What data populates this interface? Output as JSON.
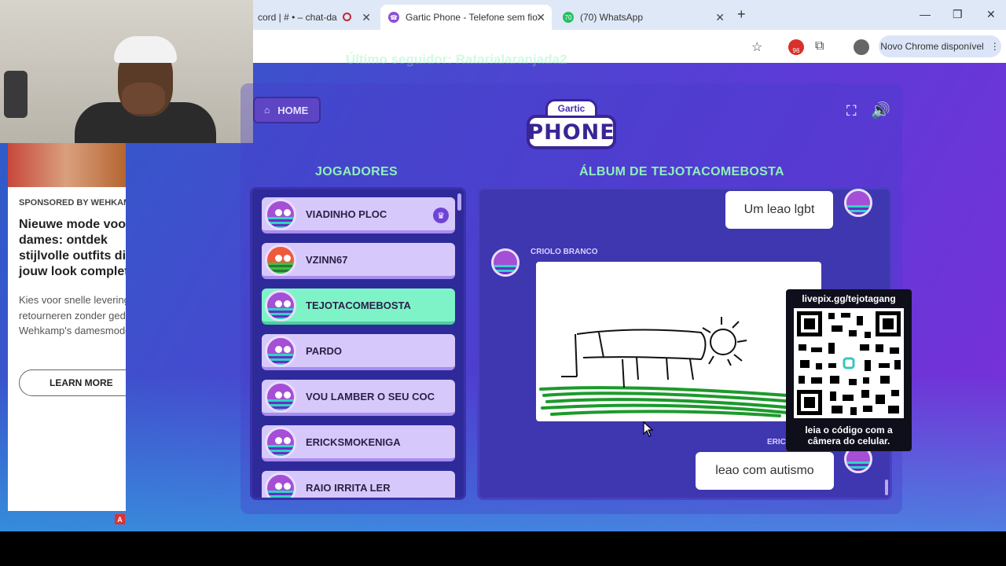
{
  "browser": {
    "tabs": [
      {
        "label": "cord | # • – chat-da",
        "icon": "discord-icon"
      },
      {
        "label": "Gartic Phone - Telefone sem fio",
        "icon": "gartic-icon"
      },
      {
        "label": "(70) WhatsApp",
        "icon": "whatsapp-icon",
        "badge": "70"
      }
    ],
    "new_tab": "+",
    "update_button": "Novo Chrome disponível",
    "extension_badge": "96"
  },
  "overlay": {
    "follower_text": "Último seguidor: Ratarialaranjada2"
  },
  "ad": {
    "sponsor": "SPONSORED BY WEHKAMP",
    "headline": "Nieuwe mode voor dames: ontdek stijlvolle outfits die jouw look complete",
    "body": "Kies voor snelle levering en retourneren zonder gedoe bij Wehkamp's damesmode.",
    "cta": "LEARN MORE",
    "badge": "A"
  },
  "game": {
    "home_label": "HOME",
    "logo_top": "Gartic",
    "logo_bottom": "PHONE",
    "players_title": "JOGADORES",
    "album_title": "ÁLBUM DE TEJOTACOMEBOSTA",
    "players": [
      {
        "name": "VIADINHO PLOC",
        "host": true
      },
      {
        "name": "VZINN67"
      },
      {
        "name": "TEJOTACOMEBOSTA",
        "active": true
      },
      {
        "name": "PARDO"
      },
      {
        "name": "VOU LAMBER O SEU COC"
      },
      {
        "name": "ERICKSMOKENIGA"
      },
      {
        "name": "RAIO IRRITA LER"
      }
    ],
    "album": {
      "first_caption": "Um leao lgbt",
      "drawing_author": "CRIOLO BRANCO",
      "second_author": "ERIC",
      "second_caption": "leao com autismo"
    }
  },
  "qr": {
    "url": "livepix.gg/tejotagang",
    "caption_line1": "leia o código com a",
    "caption_line2": "câmera do celular."
  }
}
